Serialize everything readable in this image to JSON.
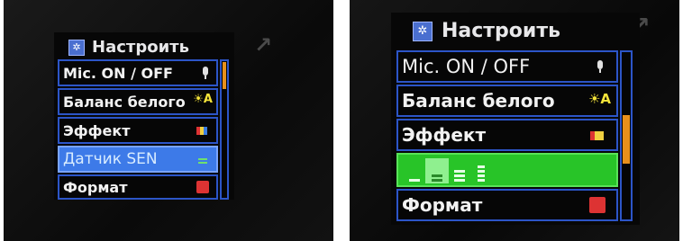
{
  "left_screen": {
    "title": "Настроить",
    "title_icon": "gear-icon",
    "items": [
      {
        "label": "Mic. ON / OFF",
        "icon": "microphone-icon"
      },
      {
        "label": "Баланс белого",
        "icon": "white-balance-icon"
      },
      {
        "label": "Эффект",
        "icon": "effect-icon"
      },
      {
        "label": "Датчик SEN",
        "icon": "sensor-level-icon",
        "selected": true
      },
      {
        "label": "Формат",
        "icon": "format-icon"
      }
    ],
    "scroll_fraction": 0.0
  },
  "right_screen": {
    "title": "Настроить",
    "title_icon": "gear-icon",
    "items": [
      {
        "label": "Mic. ON / OFF",
        "icon": "microphone-icon"
      },
      {
        "label": "Баланс белого",
        "icon": "white-balance-icon"
      },
      {
        "label": "Эффект",
        "icon": "effect-icon"
      },
      {
        "label": "",
        "icon": "sensitivity-levels",
        "expanded": true,
        "levels": 4,
        "selected_level": 2
      },
      {
        "label": "Формат",
        "icon": "format-icon"
      }
    ],
    "scroll_fraction": 0.45
  },
  "colors": {
    "highlight": "#3d7ae8",
    "border": "#2c55c8",
    "expanded": "#28c428",
    "scroll_thumb": "#e8901c"
  }
}
